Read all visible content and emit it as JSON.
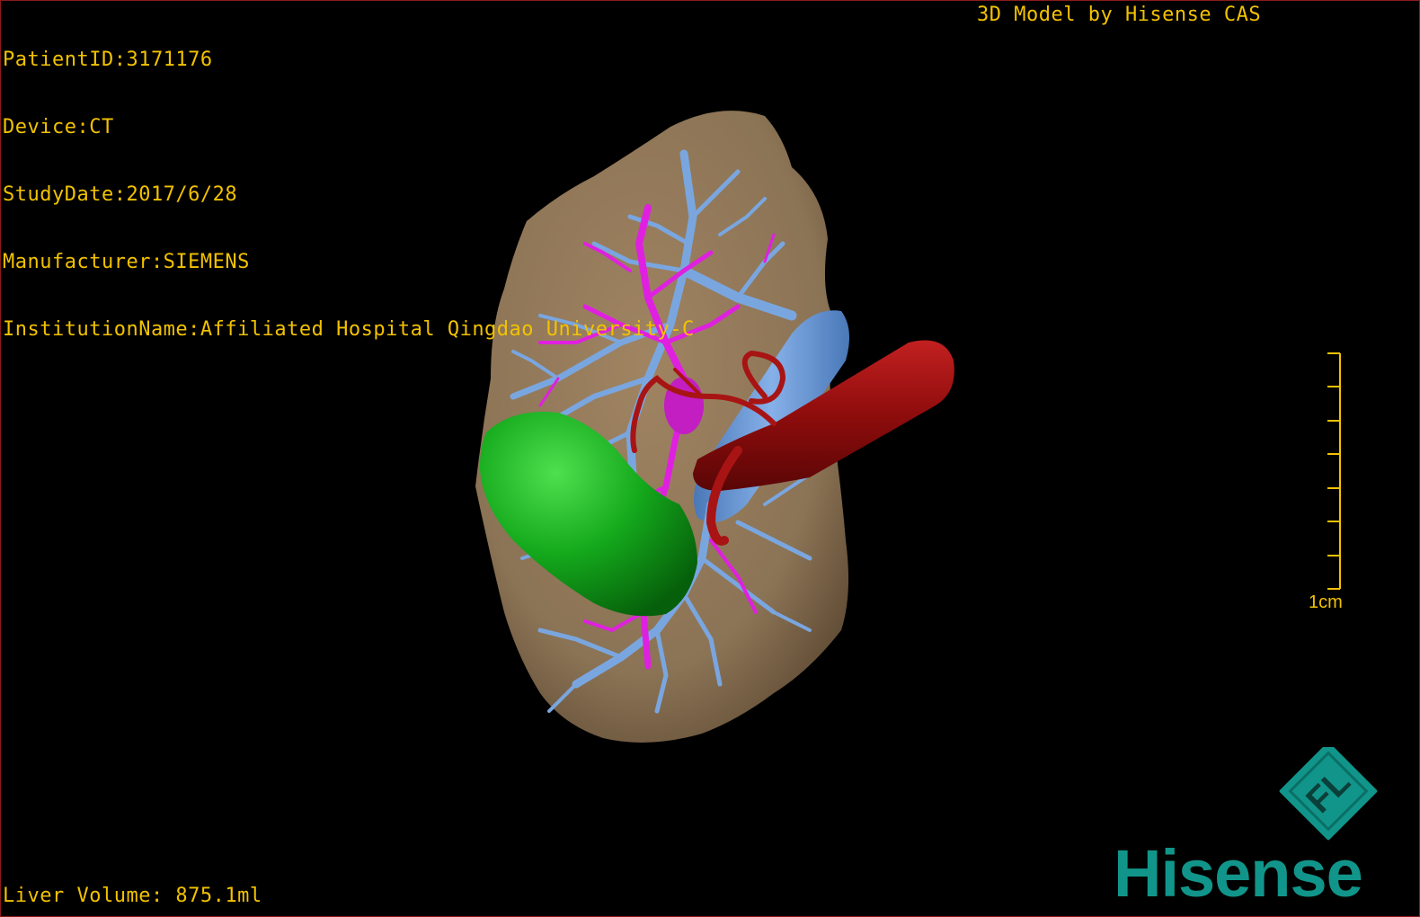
{
  "header": {
    "patient_id": "PatientID:3171176",
    "device": "Device:CT",
    "study_date": "StudyDate:2017/6/28",
    "manufacturer": "Manufacturer:SIEMENS",
    "institution": "InstitutionName:Affiliated Hospital Qingdao University-C"
  },
  "credit": "3D Model by Hisense CAS",
  "footer": {
    "liver_volume": "Liver Volume: 875.1ml"
  },
  "scale": {
    "label": "1cm",
    "color": "#f2c200"
  },
  "logo": {
    "emblem_text": "FL",
    "brand_text": "Hisense",
    "color": "#11958a"
  },
  "model_colors": {
    "liver": "#8b7355",
    "portal_vein": "#7aa6e0",
    "hepatic_artery": "#e020e0",
    "aorta": "#a01010",
    "gallbladder": "#10a818"
  }
}
